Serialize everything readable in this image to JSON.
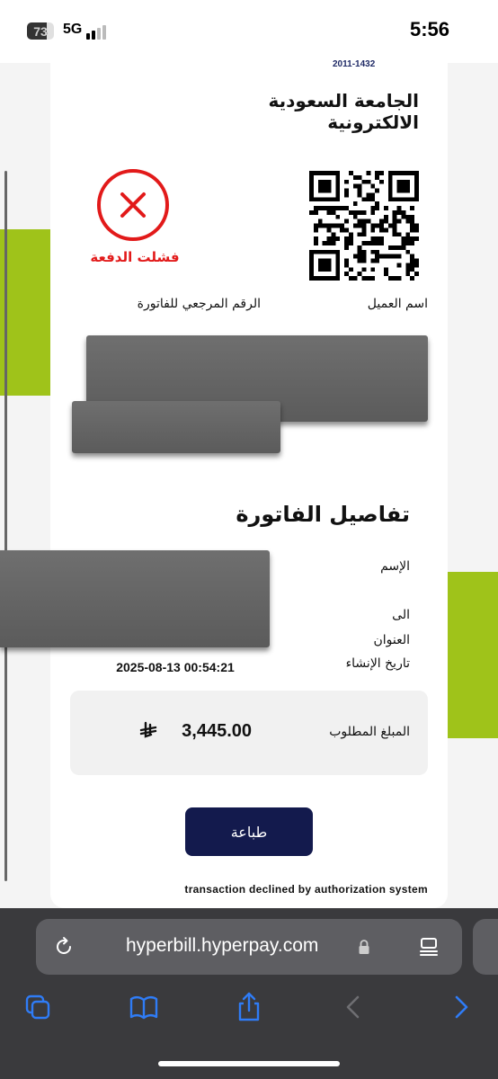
{
  "status_bar": {
    "battery": "73",
    "battery_level": 0.73,
    "network": "5G",
    "signal_bars_active": 2,
    "time": "5:56"
  },
  "invoice": {
    "year_badge": "2011-1432",
    "university": "الجامعة السعودية الالكترونية",
    "status_text": "فشلت الدفعة",
    "client_name_label": "اسم العميل",
    "reference_label": "الرقم المرجعي للفاتورة",
    "details_title": "تفاصيل الفاتورة",
    "fields": {
      "name_label": "الإسم",
      "to_label": "الى",
      "address_label": "العنوان",
      "created_label": "تاريخ الإنشاء",
      "created_value": "2025-08-13 00:54:21"
    },
    "amount_label": "المبلغ المطلوب",
    "amount_value": "3,445.00",
    "print_button": "طباعة",
    "decline_message": "transaction declined by authorization system"
  },
  "browser": {
    "url": "hyperbill.hyperpay.com"
  },
  "colors": {
    "error_red": "#e21a1a",
    "navy": "#131a4d",
    "lime": "#9fc31a",
    "chrome_bg": "#3a3a3d",
    "ios_blue": "#2f7cf6"
  }
}
